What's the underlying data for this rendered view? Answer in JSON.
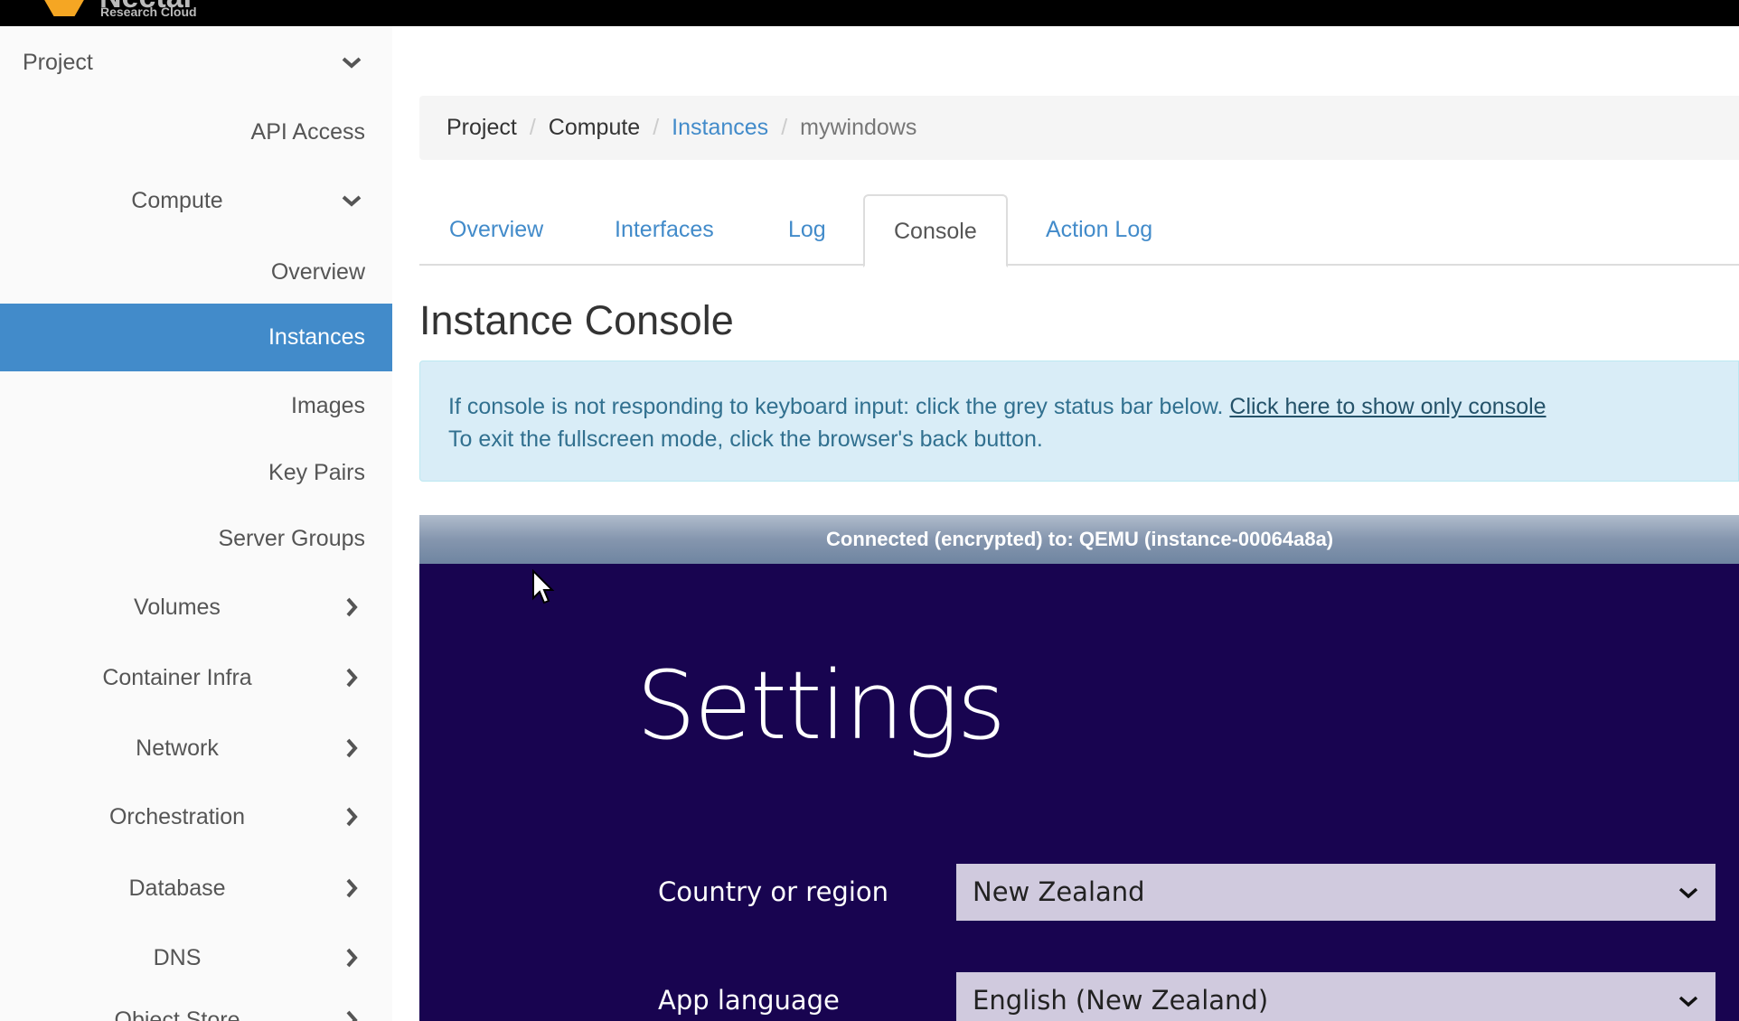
{
  "logo": {
    "name": "Nectar",
    "subtitle": "Research Cloud",
    "color": "#f5a623"
  },
  "sidebar": {
    "project": "Project",
    "items": [
      {
        "label": "API Access"
      },
      {
        "label": "Compute"
      },
      {
        "label": "Overview"
      },
      {
        "label": "Instances",
        "active": true
      },
      {
        "label": "Images"
      },
      {
        "label": "Key Pairs"
      },
      {
        "label": "Server Groups"
      },
      {
        "label": "Volumes"
      },
      {
        "label": "Container Infra"
      },
      {
        "label": "Network"
      },
      {
        "label": "Orchestration"
      },
      {
        "label": "Database"
      },
      {
        "label": "DNS"
      },
      {
        "label": "Object Store"
      }
    ],
    "active_color": "#428bca"
  },
  "breadcrumb": {
    "items": [
      "Project",
      "Compute",
      "Instances",
      "mywindows"
    ]
  },
  "tabs": [
    "Overview",
    "Interfaces",
    "Log",
    "Console",
    "Action Log"
  ],
  "active_tab": "Console",
  "title": "Instance Console",
  "alert": {
    "line1": "If console is not responding to keyboard input: click the grey status bar below.",
    "link": "Click here to show only console",
    "line2": "To exit the fullscreen mode, click the browser's back button."
  },
  "console": {
    "status": "Connected (encrypted) to: QEMU (instance-00064a8a)",
    "heading": "Settings",
    "fields": [
      {
        "label": "Country or region",
        "value": "New Zealand"
      },
      {
        "label": "App language",
        "value": "English (New Zealand)"
      }
    ],
    "background": "#180450"
  }
}
